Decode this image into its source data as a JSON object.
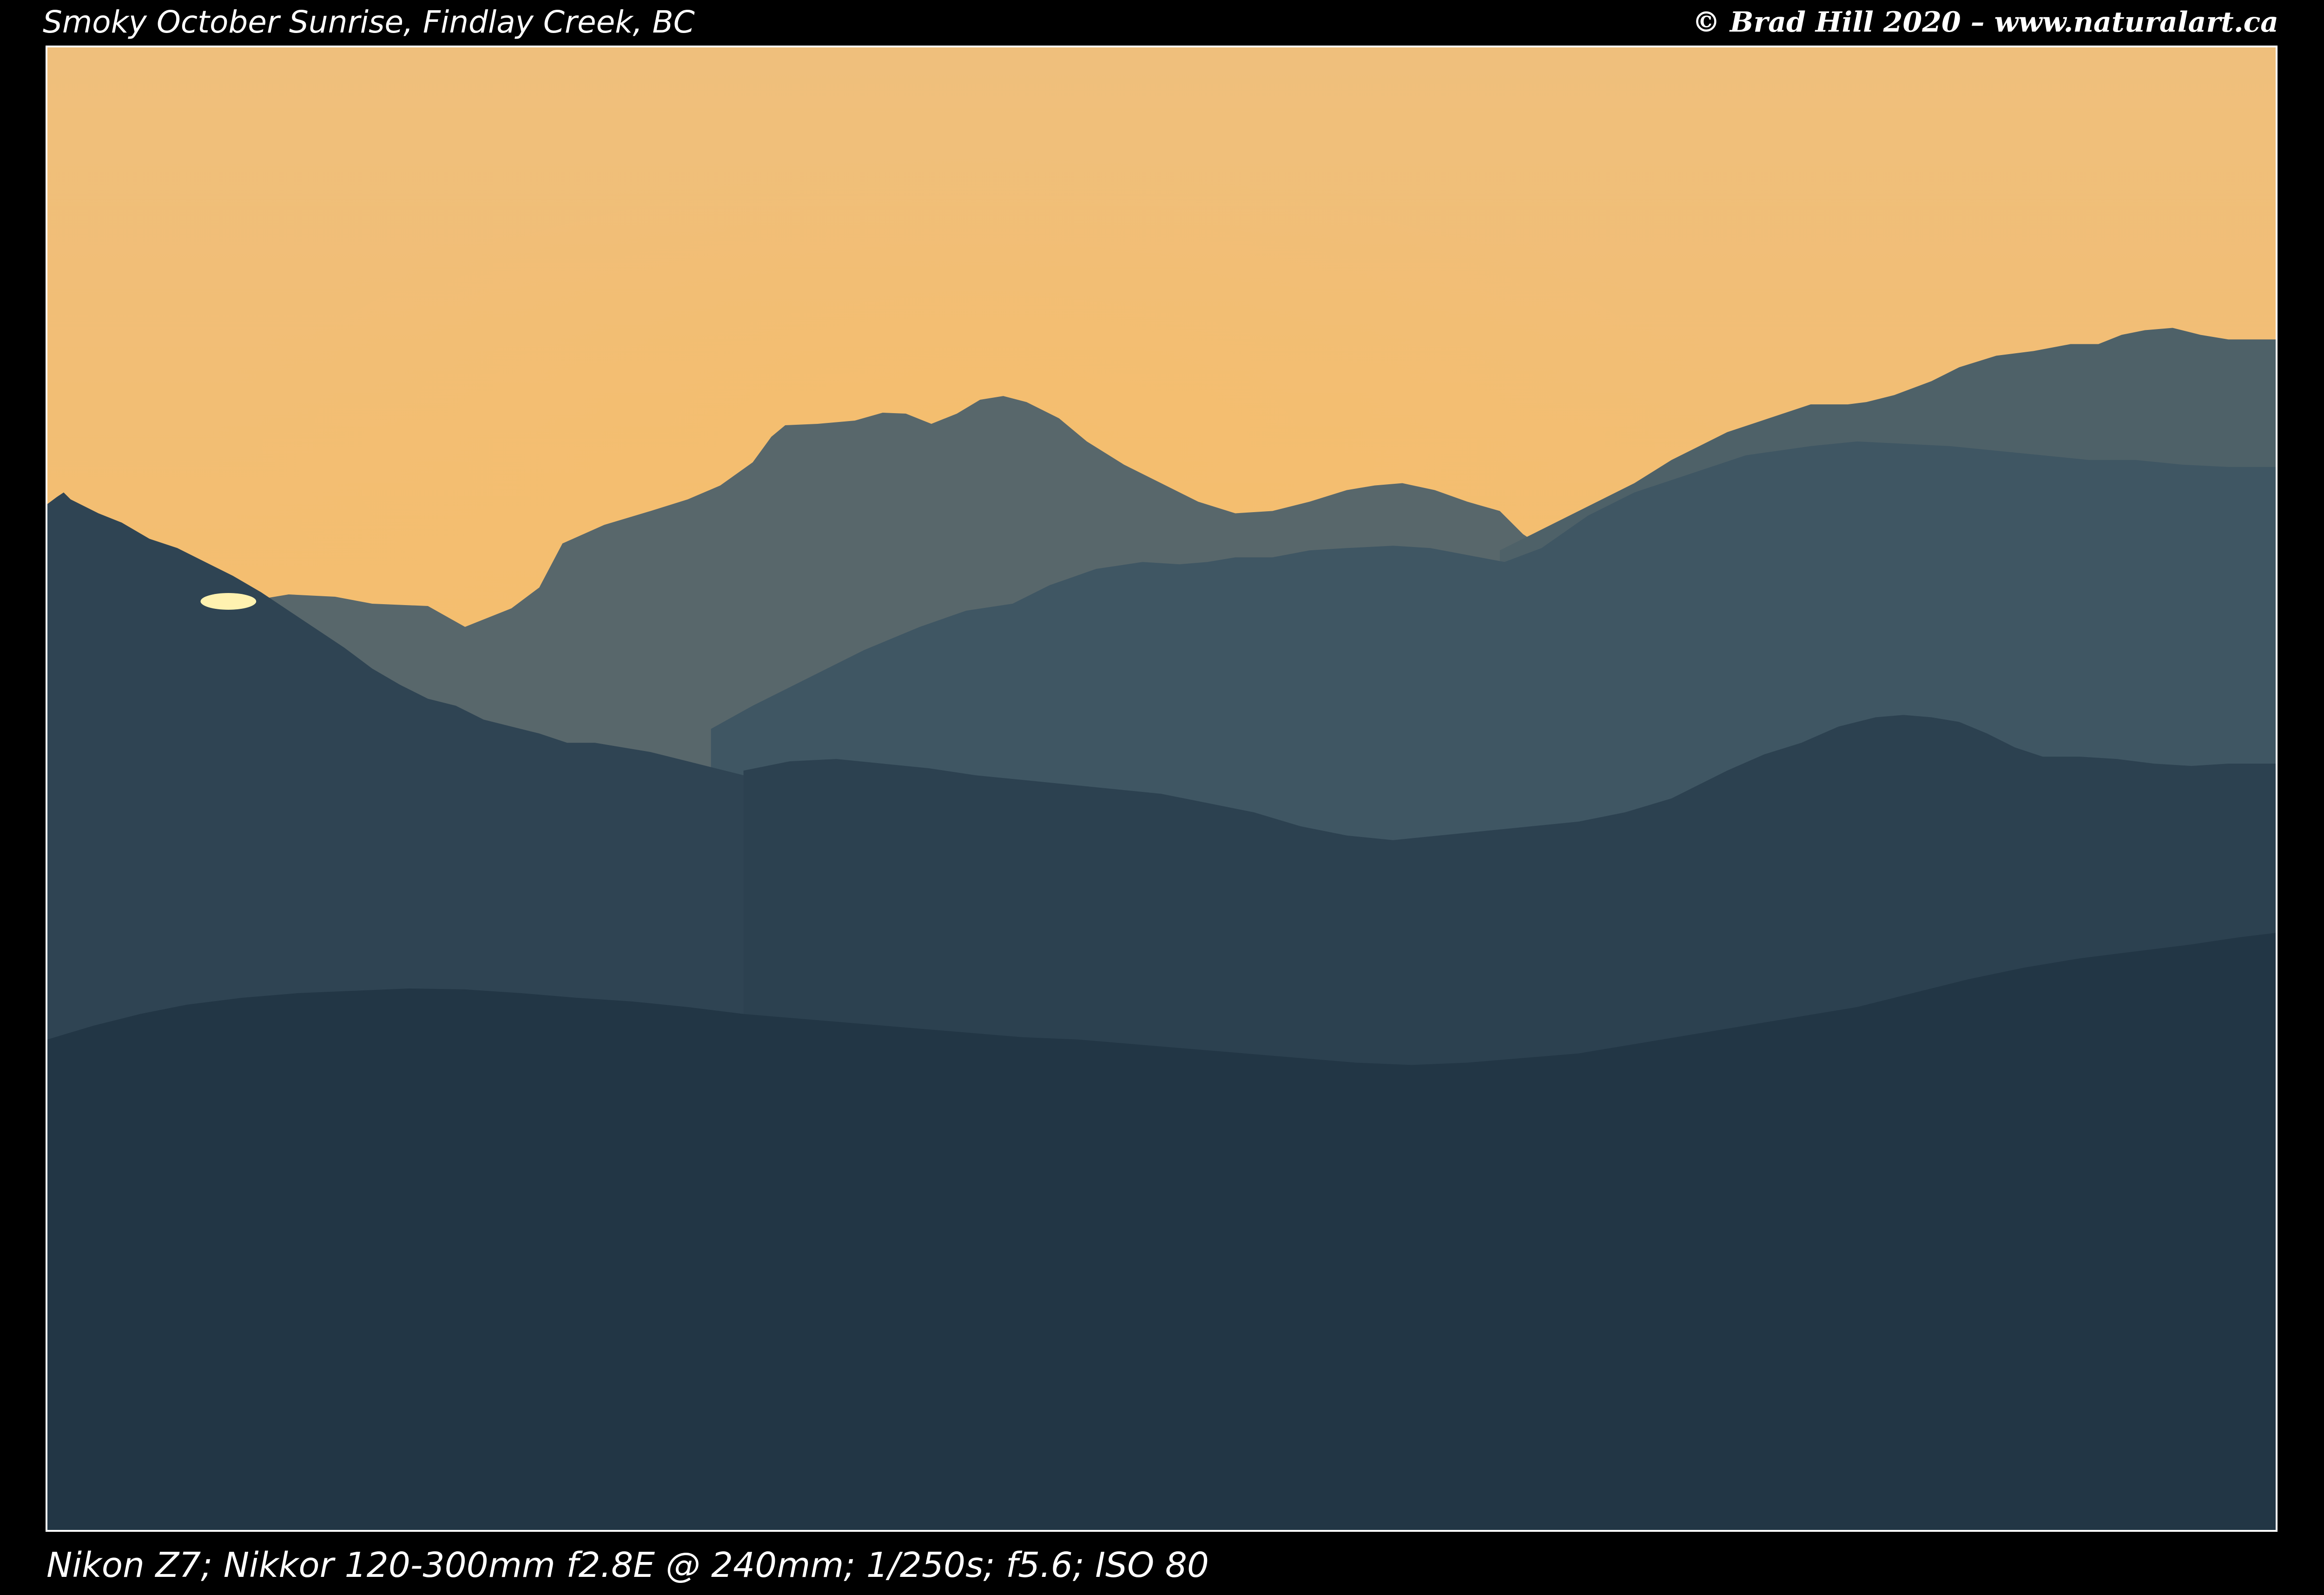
{
  "caption": {
    "title": "Smoky October Sunrise, Findlay Creek, BC",
    "copyright": "© Brad Hill 2020 – www.naturalart.ca",
    "exif": "Nikon Z7; Nikkor 120-300mm f2.8E @ 240mm; 1/250s; f5.6; ISO 80"
  },
  "photo": {
    "subject": "layered mountain ridges silhouetted against a smoky orange sunrise sky",
    "colors": {
      "sky_top": "#efbf7c",
      "sky_glow": "#f6bd6a",
      "sky_horizon": "#f1b067",
      "ridge_far": "#58676b",
      "ridge_far_right": "#4e6168",
      "ridge_mid": "#3f5663",
      "ridge_near_left": "#2f4453",
      "ridge_mid_right": "#2c4150",
      "ridge_foreground": "#223645",
      "sun_spark": "#fff2b0"
    }
  }
}
